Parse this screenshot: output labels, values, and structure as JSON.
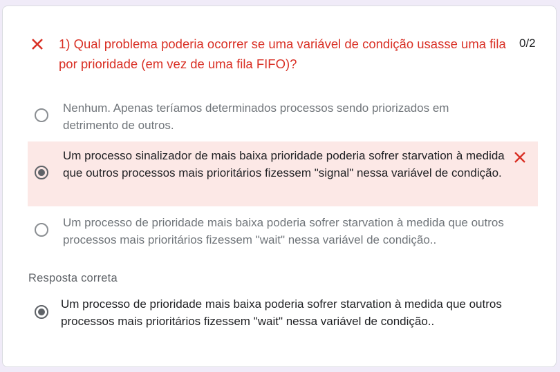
{
  "question": {
    "text": "1) Qual problema poderia ocorrer se uma variável de condição usasse uma fila por prioridade (em vez de uma fila FIFO)?",
    "score": "0/2",
    "status_icon": "close-icon",
    "status_color": "#d93025"
  },
  "options": [
    {
      "text": "Nenhum. Apenas teríamos determinados processos sendo priorizados em detrimento de outros.",
      "selected": false
    },
    {
      "text": "Um processo sinalizador de mais baixa prioridade poderia sofrer starvation à medida que outros processos mais prioritários fizessem \"signal\" nessa variável de condição.",
      "selected": true,
      "marked_wrong": true
    },
    {
      "text": "Um processo de prioridade mais baixa poderia sofrer starvation à medida que outros processos mais prioritários fizessem \"wait\" nessa variável de condição..",
      "selected": false
    }
  ],
  "correct_answer": {
    "label": "Resposta correta",
    "text": "Um processo de prioridade mais baixa poderia sofrer starvation à medida que outros processos mais prioritários fizessem \"wait\" nessa variável de condição.."
  },
  "colors": {
    "wrong_bg": "#fce8e6",
    "wrong_accent": "#d93025",
    "page_bg": "#f0ebf8"
  }
}
